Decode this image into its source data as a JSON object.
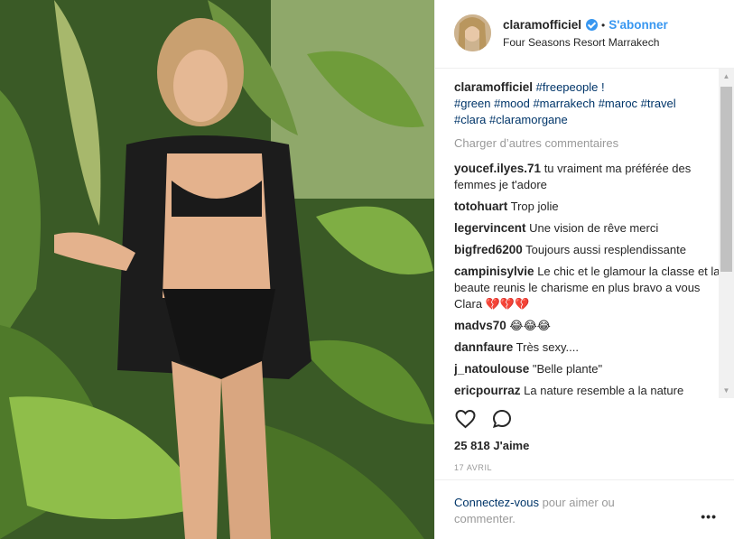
{
  "post": {
    "image_alt": "Photo"
  },
  "header": {
    "username": "claramofficiel",
    "separator": "•",
    "follow_label": "S'abonner",
    "location": "Four Seasons Resort Marrakech"
  },
  "caption": {
    "username": "claramofficiel",
    "tags_line1": "#freepeople !",
    "tags_line2": "#green #mood #marrakech #maroc #travel",
    "tags_line3": "#clara #claramorgane"
  },
  "load_more_label": "Charger d’autres commentaires",
  "comments": [
    {
      "user": "youcef.ilyes.71",
      "text": "tu vraiment ma préférée des femmes je t'adore"
    },
    {
      "user": "totohuart",
      "text": "Trop jolie"
    },
    {
      "user": "legervincent",
      "text": "Une vision de rêve merci"
    },
    {
      "user": "bigfred6200",
      "text": "Toujours aussi resplendissante"
    },
    {
      "user": "campinisylvie",
      "text": "Le chic et le glamour la classe et la beaute reunis le charisme en plus bravo a vous Clara 💔💔💔"
    },
    {
      "user": "madvs70",
      "text": "😂😂😂"
    },
    {
      "user": "dannfaure",
      "text": "Très sexy...."
    },
    {
      "user": "j_natoulouse",
      "text": "\"Belle plante\""
    },
    {
      "user": "ericpourraz",
      "text": "La nature resemble a la nature"
    }
  ],
  "likes": {
    "count": "25 818",
    "label": "J'aime"
  },
  "date": "17 AVRIL",
  "footer": {
    "login_link": "Connectez-vous",
    "login_text": "pour aimer ou commenter.",
    "more_label": "•••"
  },
  "icons": {
    "like": "heart-icon",
    "comment": "comment-icon",
    "verified": "verified-badge-icon"
  },
  "colors": {
    "accent": "#3897f0",
    "link": "#003569",
    "muted": "#999999"
  }
}
